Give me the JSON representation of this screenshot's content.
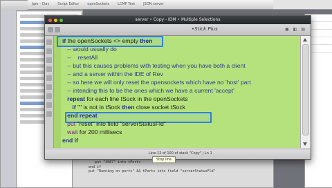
{
  "desktop": {
    "tabs": [
      "Jqm - Clay",
      "Script Editor",
      "openSockets",
      "LCMP Test",
      "JSON server"
    ]
  },
  "window": {
    "title": "server • Copy - IDM • Multiple Selections",
    "menu_title": "•Stick Plus"
  },
  "code_lines": [
    [
      {
        "t": "if",
        "c": "kw"
      },
      {
        "t": " the openSockets <> empty ",
        "c": ""
      },
      {
        "t": "then",
        "c": "kw"
      }
    ],
    [
      {
        "t": "   -- would usually do",
        "c": "cmt"
      }
    ],
    [
      {
        "t": "   --    resetAll",
        "c": "cmt"
      }
    ],
    [
      {
        "t": "   -- but this causes problems with testing when you have both a client",
        "c": "cmt"
      }
    ],
    [
      {
        "t": "   -- and a server within the IDE of Rev",
        "c": "cmt"
      }
    ],
    [
      {
        "t": "   -- so here we will only reset the opensockets which have no 'host' part",
        "c": "cmt"
      }
    ],
    [
      {
        "t": "   -- intending this to be the ones which we have a current 'accept'",
        "c": "cmt"
      }
    ],
    [
      {
        "t": "   repeat",
        "c": "kw"
      },
      {
        "t": " for each line tSock in the openSockets",
        "c": ""
      }
    ],
    [
      {
        "t": "      if ",
        "c": "kw"
      },
      {
        "t": "\"",
        "c": ""
      },
      {
        "t": "\" is not in tSock ",
        "c": ""
      },
      {
        "t": "then",
        "c": "kw"
      },
      {
        "t": " close socket tSock",
        "c": ""
      }
    ],
    [
      {
        "t": "   end repeat",
        "c": "kw"
      }
    ],
    [
      {
        "t": "   put ",
        "c": "ctl"
      },
      {
        "t": "\"reset\" into field \"serverStatusFld\"",
        "c": ""
      }
    ],
    [
      {
        "t": "   wait ",
        "c": "ctl"
      },
      {
        "t": "for 200 millisecs",
        "c": ""
      }
    ],
    [
      {
        "t": "end if",
        "c": "kw"
      }
    ]
  ],
  "status": {
    "text": "Line 12 of 100 of stack \"Copy\"  |  Ln 1",
    "tooltip": "Stop line"
  },
  "bottom_code": [
    "   put field \"portListeningFld\" into tPort",
    "   else",
    "      put \"4567\" into tPorts",
    "   end if",
    "   put \"Running on ports\" && tPorts into field \"serverStatusFld\""
  ],
  "tool_icons": [
    "pointer-icon",
    "hand-icon",
    "brush-icon",
    "pencil-icon",
    "text-icon",
    "shape-icon",
    "eyedropper-icon",
    "magnify-icon",
    "gear-icon"
  ],
  "colors": {
    "code_background": "#b6e27d",
    "highlight_border": "#2f7fe0"
  }
}
